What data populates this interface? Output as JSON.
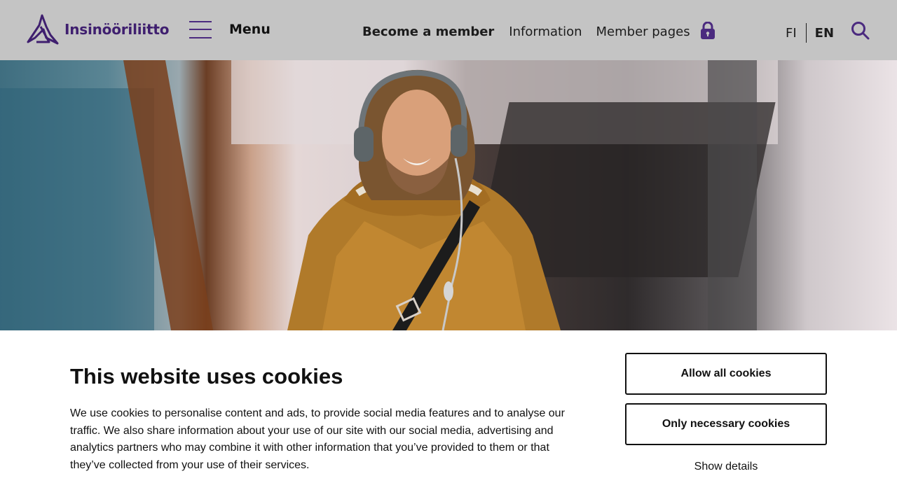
{
  "header": {
    "logo_text": "Insinööriliitto",
    "logo_icon": "insinooriliitto-logo-icon",
    "menu_label": "Menu",
    "nav": {
      "become_member": "Become a member",
      "information": "Information",
      "member_pages": "Member pages"
    },
    "lang": {
      "fi": "FI",
      "en": "EN",
      "active": "EN"
    },
    "icons": {
      "menu": "hamburger-icon",
      "lock": "lock-icon",
      "search": "search-icon"
    }
  },
  "hero": {
    "image": "man-with-headphones-in-mustard-jacket-photo"
  },
  "cookie_banner": {
    "title": "This website uses cookies",
    "body": "We use cookies to personalise content and ads, to provide social media features and to analyse our traffic. We also share information about your use of our site with our social media, advertising and analytics partners who may combine it with other information that you’ve provided to them or that they’ve collected from your use of their services.",
    "allow_all": "Allow all cookies",
    "only_necessary": "Only necessary cookies",
    "show_details": "Show details"
  },
  "colors": {
    "header_bg": "#c4c4c4",
    "brand_purple": "#3f1f6f",
    "text": "#111111",
    "banner_bg": "#ffffff"
  }
}
